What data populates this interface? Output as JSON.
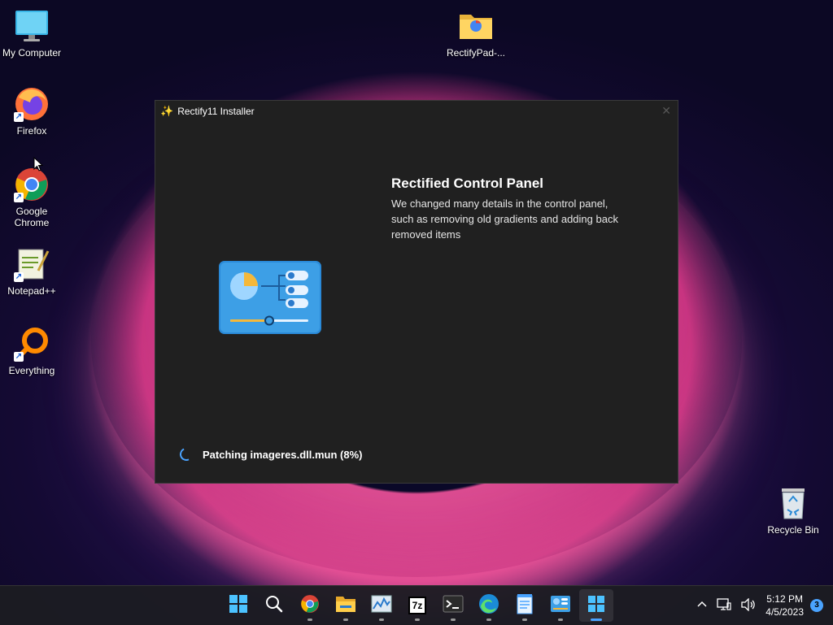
{
  "desktop": {
    "icons": {
      "my_computer": "My Computer",
      "rectifypad": "RectifyPad-...",
      "firefox": "Firefox",
      "chrome": "Google Chrome",
      "notepadpp": "Notepad++",
      "everything": "Everything",
      "recycle_bin": "Recycle Bin"
    }
  },
  "installer": {
    "title": "Rectify11 Installer",
    "feature_title": "Rectified Control Panel",
    "feature_description": "We changed many details in the control panel, such as removing old gradients and adding back removed items",
    "progress_text": "Patching imageres.dll.mun (8%)",
    "progress_percent": 8
  },
  "taskbar": {
    "apps": [
      "start-icon",
      "search-icon",
      "chrome-icon",
      "file-explorer-icon",
      "task-manager-icon",
      "7zip-icon",
      "terminal-icon",
      "edge-icon",
      "notepad-icon",
      "control-panel-icon",
      "rectify-installer-icon"
    ],
    "sevenzip_label": "7z",
    "time": "5:12 PM",
    "date": "4/5/2023",
    "notification_count": "3",
    "accent_color": "#4aa3ff"
  }
}
